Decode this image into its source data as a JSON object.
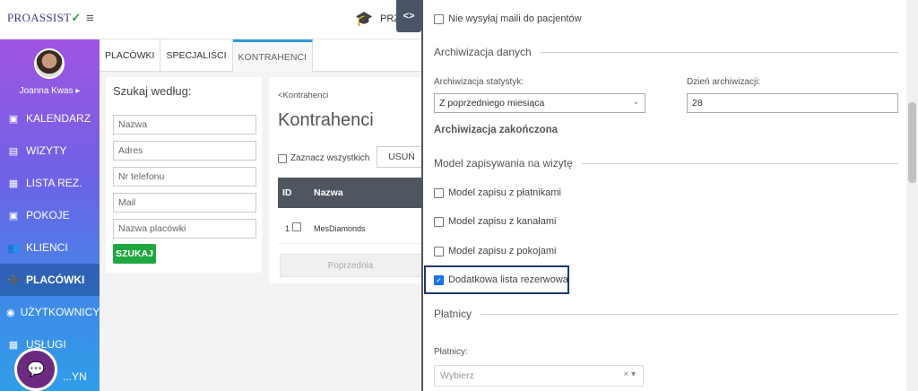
{
  "topbar": {
    "logo": "PROASSIST",
    "logo_check": "✓",
    "hamburger": "≡",
    "truncated_text": "PRZ",
    "toggle_label": "<>"
  },
  "sidebar": {
    "user_name": "Joanna Kwas ▸",
    "items": [
      {
        "label": "KALENDARZ",
        "icon": "▣"
      },
      {
        "label": "WIZYTY",
        "icon": "▤"
      },
      {
        "label": "LISTA REZ.",
        "icon": "▦"
      },
      {
        "label": "POKOJE",
        "icon": "▣"
      },
      {
        "label": "KLIENCI",
        "icon": "👥"
      },
      {
        "label": "PLACÓWKI",
        "icon": "➕"
      },
      {
        "label": "UŻYTKOWNICY",
        "icon": "◉"
      },
      {
        "label": "USŁUGI",
        "icon": "▦"
      },
      {
        "label": "...YN",
        "icon": "▣"
      }
    ],
    "chat_icon": "💬"
  },
  "tabs": [
    "PLACÓWKI",
    "SPECJALIŚCI",
    "KONTRAHENCI"
  ],
  "search": {
    "title": "Szukaj według:",
    "placeholders": [
      "Nazwa",
      "Adres",
      "Nr telefonu",
      "Mail",
      "Nazwa placówki"
    ],
    "button": "SZUKAJ"
  },
  "list": {
    "breadcrumb": "<Kontrahenci",
    "title": "Kontrahenci",
    "select_all": "Zaznacz wszystkich",
    "delete_button": "USUŃ",
    "columns": [
      "ID",
      "Nazwa"
    ],
    "rows": [
      {
        "id": "1",
        "name": "MesDiamonds"
      }
    ],
    "prev_button": "Poprzednia"
  },
  "settings": {
    "no_mail_to_patients": "Nie wysyłaj maili do pacjentów",
    "archive_section": "Archiwizacja danych",
    "archive_stats_label": "Archiwizacja statystyk:",
    "archive_stats_value": "Z poprzedniego miesiąca",
    "archive_day_label": "Dzień archiwizacji:",
    "archive_day_value": "28",
    "archive_done": "Archiwizacja zakończona",
    "booking_model_section": "Model zapisywania na wizytę",
    "options": [
      {
        "label": "Model zapisu z płatnikami",
        "checked": false
      },
      {
        "label": "Model zapisu z kanałami",
        "checked": false
      },
      {
        "label": "Model zapisu z pokojami",
        "checked": false
      },
      {
        "label": "Dodatkowa lista rezerwowa",
        "checked": true
      }
    ],
    "payers_section": "Płatnicy",
    "payers_label": "Płatnicy:",
    "payers_placeholder": "Wybierz",
    "payers_controls": "× ▾"
  },
  "colors": {
    "sidebar_gradient_start": "#a054e0",
    "sidebar_gradient_end": "#2f9ee8",
    "search_button": "#1fa83f",
    "table_header": "#4f5660",
    "highlight_border": "#1e3a6e"
  }
}
